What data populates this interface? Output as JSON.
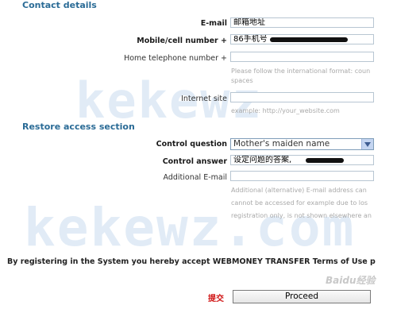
{
  "contact": {
    "section_title": "Contact details",
    "email_label": "E-mail",
    "email_value": "邮箱地址",
    "mobile_label": "Mobile/cell number +",
    "mobile_value": "86手机号",
    "home_phone_label": "Home telephone number +",
    "home_phone_hint_1": "Please follow the international format: coun",
    "home_phone_hint_2": "spaces",
    "site_label": "Internet site",
    "site_hint": "example: http://your_website.com"
  },
  "restore": {
    "section_title": "Restore access section",
    "question_label": "Control question",
    "question_selected": "Mother's maiden name",
    "answer_label": "Control answer",
    "answer_value": "设定问题的答案,",
    "additional_email_label": "Additional E-mail",
    "additional_email_hint_1": "Additional (alternative) E-mail address can",
    "additional_email_hint_2": "cannot be accessed for example due to los",
    "additional_email_hint_3": "registration only, is not shown elsewhere an"
  },
  "terms_text": "By registering in the System you hereby accept WEBMONEY TRANSFER Terms of Use p",
  "submit_label": "提交",
  "proceed_label": "Proceed",
  "watermark_1": "kekewz",
  "watermark_2": "kekewz.com",
  "logo_text": "Baidu经验",
  "icons": {
    "dropdown": "chevron-down-icon"
  },
  "colors": {
    "section": "#2a6b96",
    "submit": "#d01515",
    "field_border": "#b8c6d2"
  }
}
